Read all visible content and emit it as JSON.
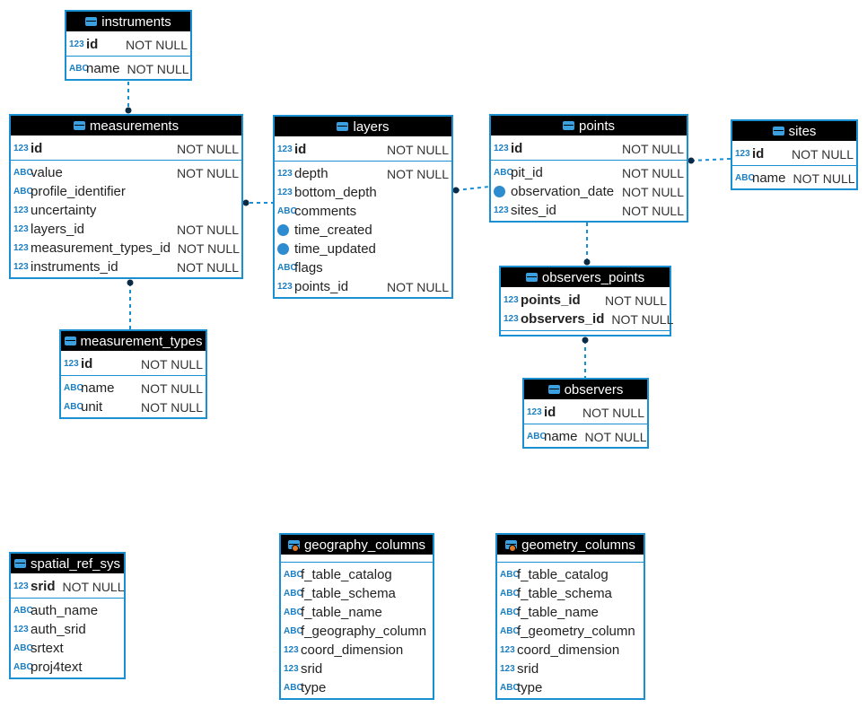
{
  "accent_color": "#1a8fd1",
  "tables": [
    {
      "name": "instruments",
      "kind": "table",
      "keys": [
        {
          "name": "id",
          "type": "123",
          "nullable": "NOT NULL"
        }
      ],
      "columns": [
        {
          "name": "name",
          "type": "ABC",
          "nullable": "NOT NULL"
        }
      ]
    },
    {
      "name": "measurements",
      "kind": "table",
      "keys": [
        {
          "name": "id",
          "type": "123",
          "nullable": "NOT NULL"
        }
      ],
      "columns": [
        {
          "name": "value",
          "type": "ABC",
          "nullable": "NOT NULL"
        },
        {
          "name": "profile_identifier",
          "type": "ABC",
          "nullable": ""
        },
        {
          "name": "uncertainty",
          "type": "123",
          "nullable": ""
        },
        {
          "name": "layers_id",
          "type": "123",
          "nullable": "NOT NULL"
        },
        {
          "name": "measurement_types_id",
          "type": "123",
          "nullable": "NOT NULL"
        },
        {
          "name": "instruments_id",
          "type": "123",
          "nullable": "NOT NULL"
        }
      ]
    },
    {
      "name": "layers",
      "kind": "table",
      "keys": [
        {
          "name": "id",
          "type": "123",
          "nullable": "NOT NULL"
        }
      ],
      "columns": [
        {
          "name": "depth",
          "type": "123",
          "nullable": "NOT NULL"
        },
        {
          "name": "bottom_depth",
          "type": "123",
          "nullable": ""
        },
        {
          "name": "comments",
          "type": "ABC",
          "nullable": ""
        },
        {
          "name": "time_created",
          "type": "clock",
          "nullable": ""
        },
        {
          "name": "time_updated",
          "type": "clock",
          "nullable": ""
        },
        {
          "name": "flags",
          "type": "ABC",
          "nullable": ""
        },
        {
          "name": "points_id",
          "type": "123",
          "nullable": "NOT NULL"
        }
      ]
    },
    {
      "name": "points",
      "kind": "table",
      "keys": [
        {
          "name": "id",
          "type": "123",
          "nullable": "NOT NULL"
        }
      ],
      "columns": [
        {
          "name": "pit_id",
          "type": "ABC",
          "nullable": "NOT NULL"
        },
        {
          "name": "observation_date",
          "type": "clock",
          "nullable": "NOT NULL"
        },
        {
          "name": "sites_id",
          "type": "123",
          "nullable": "NOT NULL"
        }
      ]
    },
    {
      "name": "sites",
      "kind": "table",
      "keys": [
        {
          "name": "id",
          "type": "123",
          "nullable": "NOT NULL"
        }
      ],
      "columns": [
        {
          "name": "name",
          "type": "ABC",
          "nullable": "NOT NULL"
        }
      ]
    },
    {
      "name": "observers_points",
      "kind": "table",
      "keys": [
        {
          "name": "points_id",
          "type": "123",
          "nullable": "NOT NULL"
        },
        {
          "name": "observers_id",
          "type": "123",
          "nullable": "NOT NULL"
        }
      ],
      "columns": []
    },
    {
      "name": "measurement_types",
      "kind": "table",
      "keys": [
        {
          "name": "id",
          "type": "123",
          "nullable": "NOT NULL"
        }
      ],
      "columns": [
        {
          "name": "name",
          "type": "ABC",
          "nullable": "NOT NULL"
        },
        {
          "name": "unit",
          "type": "ABC",
          "nullable": "NOT NULL"
        }
      ]
    },
    {
      "name": "observers",
      "kind": "table",
      "keys": [
        {
          "name": "id",
          "type": "123",
          "nullable": "NOT NULL"
        }
      ],
      "columns": [
        {
          "name": "name",
          "type": "ABC",
          "nullable": "NOT NULL"
        }
      ]
    },
    {
      "name": "spatial_ref_sys",
      "kind": "table",
      "keys": [
        {
          "name": "srid",
          "type": "123",
          "nullable": "NOT NULL"
        }
      ],
      "columns": [
        {
          "name": "auth_name",
          "type": "ABC",
          "nullable": ""
        },
        {
          "name": "auth_srid",
          "type": "123",
          "nullable": ""
        },
        {
          "name": "srtext",
          "type": "ABC",
          "nullable": ""
        },
        {
          "name": "proj4text",
          "type": "ABC",
          "nullable": ""
        }
      ]
    },
    {
      "name": "geography_columns",
      "kind": "view",
      "keys": [],
      "columns": [
        {
          "name": "f_table_catalog",
          "type": "ABC",
          "nullable": ""
        },
        {
          "name": "f_table_schema",
          "type": "ABC",
          "nullable": ""
        },
        {
          "name": "f_table_name",
          "type": "ABC",
          "nullable": ""
        },
        {
          "name": "f_geography_column",
          "type": "ABC",
          "nullable": ""
        },
        {
          "name": "coord_dimension",
          "type": "123",
          "nullable": ""
        },
        {
          "name": "srid",
          "type": "123",
          "nullable": ""
        },
        {
          "name": "type",
          "type": "ABC",
          "nullable": ""
        }
      ]
    },
    {
      "name": "geometry_columns",
      "kind": "view",
      "keys": [],
      "columns": [
        {
          "name": "f_table_catalog",
          "type": "ABC",
          "nullable": ""
        },
        {
          "name": "f_table_schema",
          "type": "ABC",
          "nullable": ""
        },
        {
          "name": "f_table_name",
          "type": "ABC",
          "nullable": ""
        },
        {
          "name": "f_geometry_column",
          "type": "ABC",
          "nullable": ""
        },
        {
          "name": "coord_dimension",
          "type": "123",
          "nullable": ""
        },
        {
          "name": "srid",
          "type": "123",
          "nullable": ""
        },
        {
          "name": "type",
          "type": "ABC",
          "nullable": ""
        }
      ]
    }
  ],
  "relationships": [
    {
      "from": "measurements",
      "to": "instruments"
    },
    {
      "from": "measurements",
      "to": "layers"
    },
    {
      "from": "measurements",
      "to": "measurement_types"
    },
    {
      "from": "layers",
      "to": "points"
    },
    {
      "from": "points",
      "to": "sites"
    },
    {
      "from": "observers_points",
      "to": "points"
    },
    {
      "from": "observers_points",
      "to": "observers"
    }
  ]
}
